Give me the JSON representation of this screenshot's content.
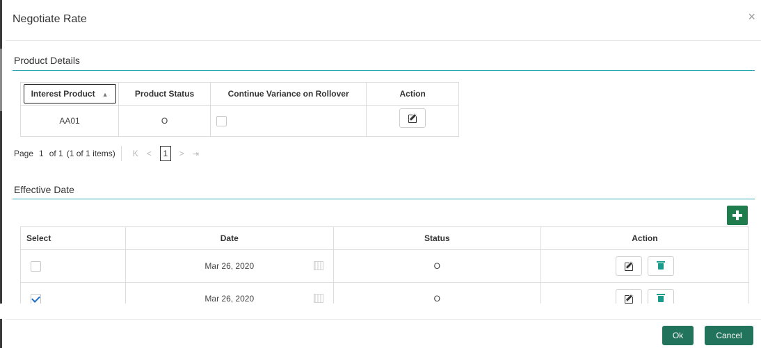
{
  "modal": {
    "title": "Negotiate Rate",
    "close_glyph": "×"
  },
  "product_details": {
    "section_title": "Product Details",
    "columns": [
      "Interest Product",
      "Product Status",
      "Continue Variance on Rollover",
      "Action"
    ],
    "sort_glyph": "▲",
    "rows": [
      {
        "interest_product": "AA01",
        "product_status": "O",
        "continue_variance": false
      }
    ],
    "pager": {
      "page_label": "Page",
      "page_value": "1",
      "of_label": "of 1",
      "items_label": "(1 of 1 items)",
      "first_glyph": "K",
      "prev_glyph": "<",
      "current": "1",
      "next_glyph": ">",
      "last_glyph": "❘"
    }
  },
  "effective_date": {
    "section_title": "Effective Date",
    "columns": [
      "Select",
      "Date",
      "Status",
      "Action"
    ],
    "rows": [
      {
        "selected": false,
        "date": "Mar 26, 2020",
        "status": "O"
      },
      {
        "selected": true,
        "date": "Mar 26, 2020",
        "status": "O"
      }
    ]
  },
  "footer": {
    "ok_label": "Ok",
    "cancel_label": "Cancel"
  },
  "colors": {
    "accent_line": "#2aa9b4",
    "primary_button": "#21745b",
    "add_button": "#1f7c4d",
    "trash_icon": "#1a9c8c"
  },
  "icons": [
    "close-icon",
    "sort-asc-icon",
    "edit-icon",
    "trash-icon",
    "calendar-icon",
    "add-icon"
  ]
}
